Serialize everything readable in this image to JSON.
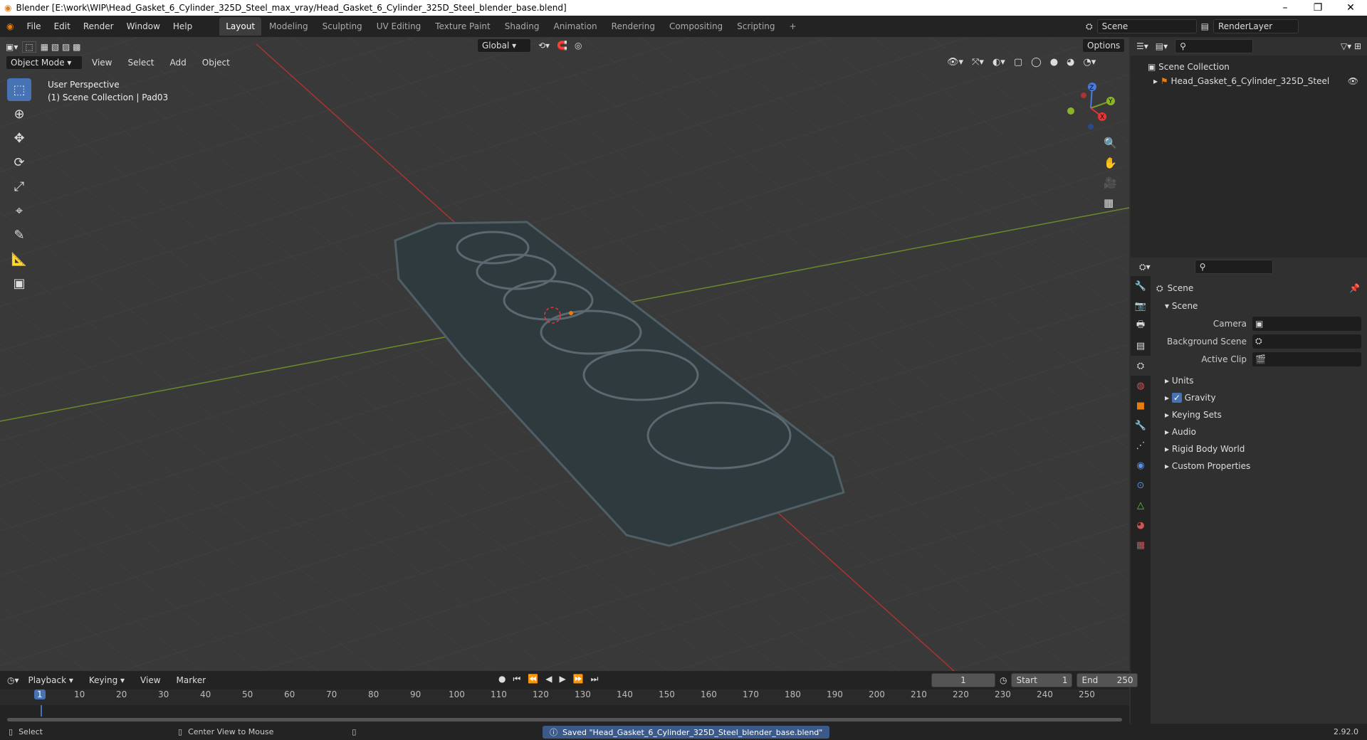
{
  "window": {
    "title": "Blender [E:\\work\\WIP\\Head_Gasket_6_Cylinder_325D_Steel_max_vray/Head_Gasket_6_Cylinder_325D_Steel_blender_base.blend]"
  },
  "menus": [
    "File",
    "Edit",
    "Render",
    "Window",
    "Help"
  ],
  "workspaces": [
    "Layout",
    "Modeling",
    "Sculpting",
    "UV Editing",
    "Texture Paint",
    "Shading",
    "Animation",
    "Rendering",
    "Compositing",
    "Scripting"
  ],
  "scene_field": "Scene",
  "layer_field": "RenderLayer",
  "viewport": {
    "mode": "Object Mode",
    "menus": [
      "View",
      "Select",
      "Add",
      "Object"
    ],
    "orientation": "Global",
    "options": "Options",
    "overlay_line1": "User Perspective",
    "overlay_line2": "(1) Scene Collection | Pad03",
    "gizmo": {
      "x": "X",
      "y": "Y",
      "z": "Z"
    }
  },
  "outliner": {
    "collection": "Scene Collection",
    "item": "Head_Gasket_6_Cylinder_325D_Steel"
  },
  "properties": {
    "context": "Scene",
    "section": "Scene",
    "rows": [
      {
        "label": "Camera"
      },
      {
        "label": "Background Scene"
      },
      {
        "label": "Active Clip"
      }
    ],
    "panels": [
      "Units",
      "Gravity",
      "Keying Sets",
      "Audio",
      "Rigid Body World",
      "Custom Properties"
    ]
  },
  "timeline": {
    "menus": [
      "Playback",
      "Keying",
      "View",
      "Marker"
    ],
    "current_frame": "1",
    "start_label": "Start",
    "start": "1",
    "end_label": "End",
    "end": "250",
    "ticks": [
      "1",
      "10",
      "20",
      "30",
      "40",
      "50",
      "60",
      "70",
      "80",
      "90",
      "100",
      "110",
      "120",
      "130",
      "140",
      "150",
      "160",
      "170",
      "180",
      "190",
      "200",
      "210",
      "220",
      "230",
      "240",
      "250"
    ]
  },
  "status": {
    "select": "Select",
    "center": "Center View to Mouse",
    "message": "Saved \"Head_Gasket_6_Cylinder_325D_Steel_blender_base.blend\"",
    "version": "2.92.0"
  }
}
